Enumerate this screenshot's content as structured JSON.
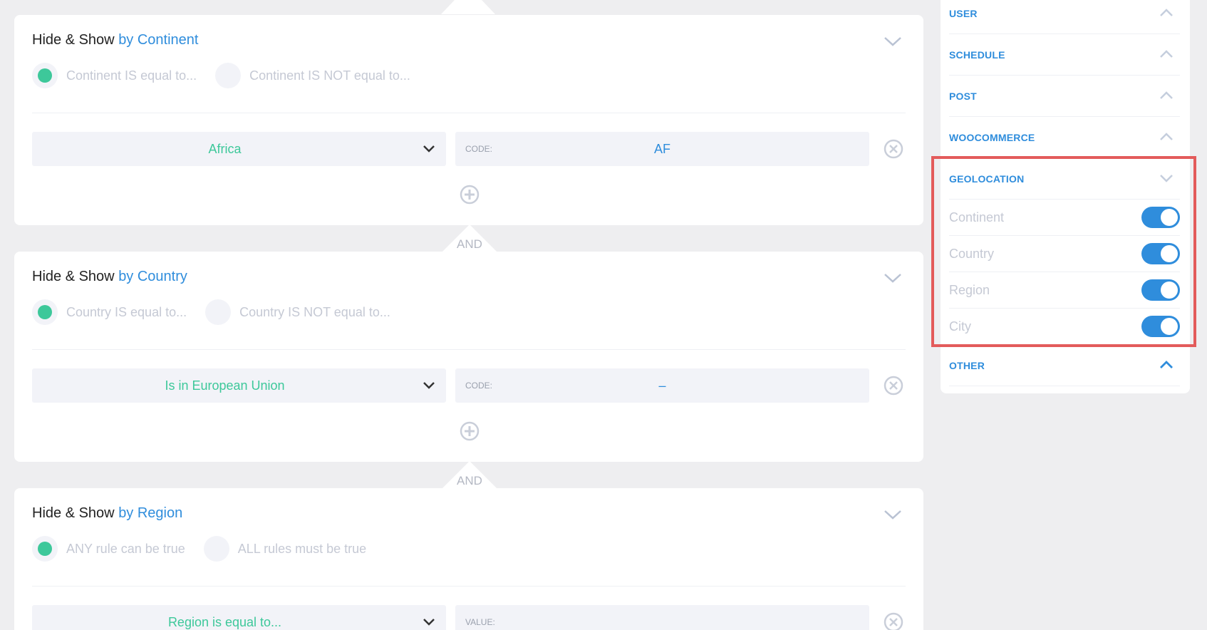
{
  "rules": [
    {
      "title_prefix": "Hide & Show",
      "title_accent": "by Continent",
      "option_selected": "Continent IS equal to...",
      "option_other": "Continent IS NOT equal to...",
      "select_value": "Africa",
      "code_label": "CODE:",
      "code_value": "AF"
    },
    {
      "title_prefix": "Hide & Show",
      "title_accent": "by Country",
      "option_selected": "Country IS equal to...",
      "option_other": "Country IS NOT equal to...",
      "select_value": "Is in European Union",
      "code_label": "CODE:",
      "code_value": "–"
    },
    {
      "title_prefix": "Hide & Show",
      "title_accent": "by Region",
      "option_selected": "ANY rule can be true",
      "option_other": "ALL rules must be true",
      "select_value": "Region is equal to...",
      "code_label": "VALUE:",
      "code_value": ""
    }
  ],
  "connector_label": "AND",
  "sidebar": {
    "sections": [
      "USER",
      "SCHEDULE",
      "POST",
      "WOOCOMMERCE",
      "GEOLOCATION",
      "OTHER"
    ],
    "geolocation_items": [
      {
        "label": "Continent",
        "enabled": true
      },
      {
        "label": "Country",
        "enabled": true
      },
      {
        "label": "Region",
        "enabled": true
      },
      {
        "label": "City",
        "enabled": true
      }
    ]
  },
  "colors": {
    "accent": "#2f8ddc",
    "selected_green": "#3dc89a",
    "highlight_red": "#e35b5b",
    "background": "#eeeef0"
  },
  "icons": {
    "collapse": "chevron-down-icon",
    "select": "chevron-down-icon",
    "remove": "close-circle-icon",
    "add": "plus-circle-icon",
    "section_expand": "chevron-up-icon"
  }
}
